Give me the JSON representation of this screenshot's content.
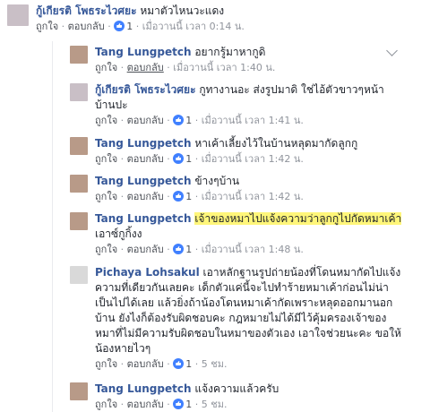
{
  "comments": [
    {
      "name": "กู้เกียรติ โพธระไวศยะ",
      "text": "หมาตัวไหนวะแดง",
      "like": "ถูกใจ",
      "reply": "ตอบกลับ",
      "reactions": "1",
      "time": "เมื่อวานนี้ เวลา 0:14 น."
    },
    {
      "name": "Tang Lungpetch",
      "text": "อยากรู้มาหากูดิ",
      "like": "ถูกใจ",
      "reply": "ตอบกลับ",
      "time": "เมื่อวานนี้ เวลา 1:40 น."
    },
    {
      "name": "กู้เกียรติ โพธระไวศยะ",
      "text1": "กูทางานอะ ส่งรูปมาดิ ใช่ไอ้ตัวขาวๆหน้า",
      "text2": "บ้านปะ",
      "like": "ถูกใจ",
      "reply": "ตอบกลับ",
      "reactions": "1",
      "time": "เมื่อวานนี้ เวลา 1:41 น."
    },
    {
      "name": "Tang Lungpetch",
      "text": "หาเค้าเลี้ยงไว้ในบ้านหลุดมากัดลูกกู",
      "like": "ถูกใจ",
      "reply": "ตอบกลับ",
      "reactions": "1",
      "time": "เมื่อวานนี้ เวลา 1:42 น."
    },
    {
      "name": "Tang Lungpetch",
      "text": "ข้างๆบ้าน",
      "like": "ถูกใจ",
      "reply": "ตอบกลับ",
      "reactions": "1",
      "time": "เมื่อวานนี้ เวลา 1:42 น."
    },
    {
      "name": "Tang Lungpetch",
      "text_hl": "เจ้าของหมาไปแจ้งความว่าลูกกูไปกัดหมาเค้า",
      "text2": "เอาซ์กูกิ้งง",
      "like": "ถูกใจ",
      "reply": "ตอบกลับ",
      "reactions": "1",
      "time": "เมื่อวานนี้ เวลา 1:48 น."
    },
    {
      "name": "Pichaya Lohsakul",
      "lines": [
        "เอาหลักฐานรูปถ่ายน้องที่โดนหมากัดไปแจ้ง",
        "ความที่เดียวกันเลยคะ เด็กตัวแค่นี้จะไปทำร้ายหมาเค้าก่อนไม่น่า",
        "เป็นไปได้เลย แล้วยิ่งถ้าน้องโดนหมาเค้ากัดเพราะหลุดออกมานอก",
        "บ้าน ยังไงก็ต้องรับผิดชอบคะ กฎหมายไม่ได้มีไว้คุ้มครองเจ้าของ",
        "หมาที่ไม่มีความรับผิดชอบในหมาของตัวเอง เอาใจช่วยนะคะ ขอให้",
        "น้องหายไวๆ"
      ],
      "like": "ถูกใจ",
      "reply": "ตอบกลับ",
      "reactions": "1",
      "time": "5 ชม."
    },
    {
      "name": "Tang Lungpetch",
      "text": "แจ้งความแล้วครับ",
      "like": "ถูกใจ",
      "reply": "ตอบกลับ",
      "reactions": "1",
      "time": "5 ชม."
    }
  ],
  "colors": {
    "name": "#365899",
    "meta": "#90949c",
    "highlight": "#fff67a",
    "like_blue": "#4080ff"
  }
}
